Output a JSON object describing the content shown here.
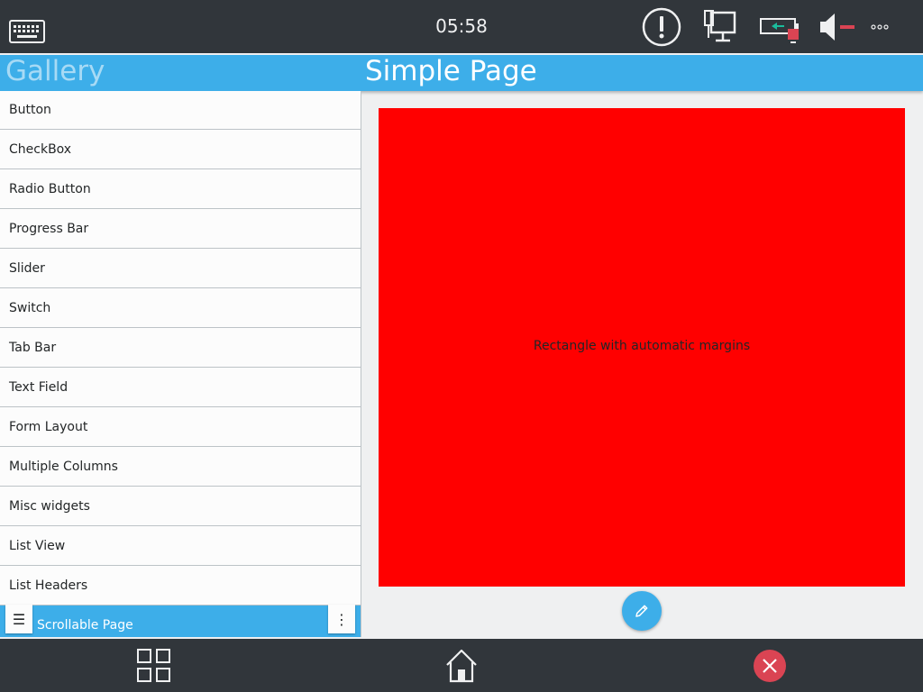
{
  "status_bar": {
    "clock": "05:58",
    "icons": [
      "keyboard-icon",
      "warning-icon",
      "network-icon",
      "battery-icon",
      "volume-muted-icon",
      "more-icon"
    ]
  },
  "header": {
    "gallery_title": "Gallery",
    "page_title": "Simple Page"
  },
  "sidebar": {
    "items": [
      {
        "label": "Button"
      },
      {
        "label": "CheckBox"
      },
      {
        "label": "Radio Button"
      },
      {
        "label": "Progress Bar"
      },
      {
        "label": "Slider"
      },
      {
        "label": "Switch"
      },
      {
        "label": "Tab Bar"
      },
      {
        "label": "Text Field"
      },
      {
        "label": "Form Layout"
      },
      {
        "label": "Multiple Columns"
      },
      {
        "label": "Misc widgets"
      },
      {
        "label": "List View"
      },
      {
        "label": "List Headers"
      },
      {
        "label": "Scrollable Page"
      }
    ],
    "active_index": 13,
    "handle_left": "☰",
    "handle_right": "⋮"
  },
  "main": {
    "rectangle_label": "Rectangle with automatic margins",
    "rectangle_color": "#ff0000"
  },
  "bottom_bar": {
    "icons": [
      "app-grid-icon",
      "home-icon",
      "close-icon"
    ]
  },
  "colors": {
    "accent": "#3daee9",
    "panel": "#31363b",
    "danger": "#da4453"
  }
}
